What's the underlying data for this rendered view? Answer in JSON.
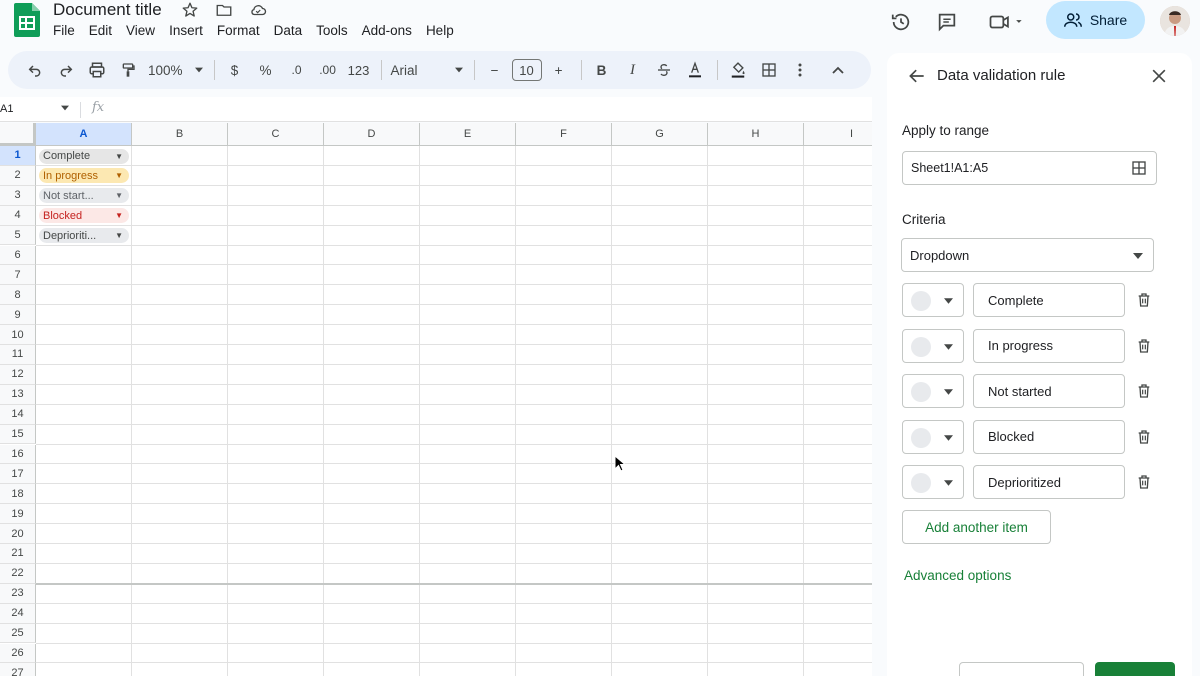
{
  "header": {
    "doc_title": "Document title",
    "menu": [
      "File",
      "Edit",
      "View",
      "Insert",
      "Format",
      "Data",
      "Tools",
      "Add-ons",
      "Help"
    ],
    "share_label": "Share"
  },
  "toolbar": {
    "zoom": "100%",
    "currency": "$",
    "percent": "%",
    "dec_decrease": ".0",
    "dec_increase": ".00",
    "number_format": "123",
    "font": "Arial",
    "font_size": "10",
    "minus": "−",
    "plus": "+",
    "bold": "B",
    "italic": "I"
  },
  "formula_bar": {
    "cell_ref": "A1",
    "fx": "fx"
  },
  "grid": {
    "columns": [
      "A",
      "B",
      "C",
      "D",
      "E",
      "F",
      "G",
      "H",
      "I"
    ],
    "rows": [
      "1",
      "2",
      "3",
      "4",
      "5",
      "6",
      "7",
      "8",
      "9",
      "10",
      "11",
      "12",
      "13",
      "14",
      "15",
      "16",
      "17",
      "18",
      "19",
      "20",
      "21",
      "22",
      "23",
      "24",
      "25",
      "26",
      "27"
    ],
    "cells": [
      {
        "text": "Complete",
        "bg": "#e6e6e6",
        "fg": "#444746"
      },
      {
        "text": "In progress",
        "bg": "#fce8b2",
        "fg": "#b06000"
      },
      {
        "text": "Not start...",
        "bg": "#e8eaed",
        "fg": "#5f6368"
      },
      {
        "text": "Blocked",
        "bg": "#fce8e6",
        "fg": "#c5221f"
      },
      {
        "text": "Deprioriti...",
        "bg": "#e8eaed",
        "fg": "#444746"
      }
    ]
  },
  "panel": {
    "title": "Data validation rule",
    "apply_label": "Apply to range",
    "range_value": "Sheet1!A1:A5",
    "criteria_label": "Criteria",
    "criteria_value": "Dropdown",
    "items": [
      "Complete",
      "In progress",
      "Not started",
      "Blocked",
      "Deprioritized"
    ],
    "add_item": "Add another item",
    "advanced": "Advanced options"
  },
  "colors": {
    "accent_green": "#188038",
    "share_bg": "#c2e7ff",
    "selected_header": "#d3e3fd"
  }
}
